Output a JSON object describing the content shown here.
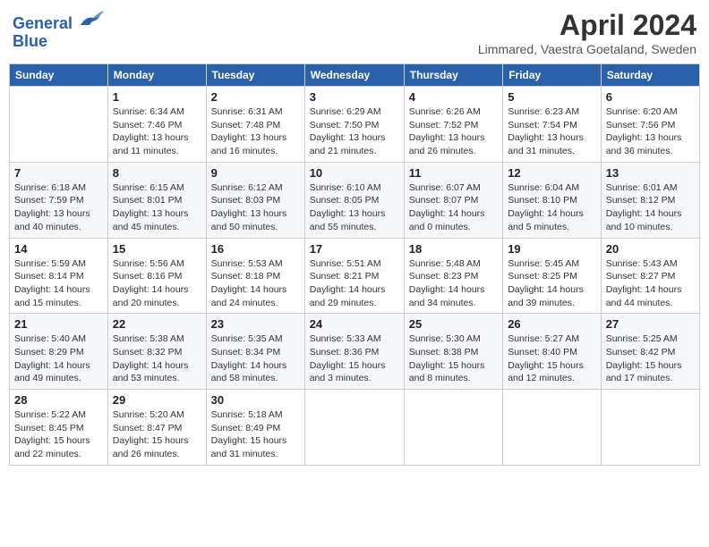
{
  "header": {
    "logo_line1": "General",
    "logo_line2": "Blue",
    "month_title": "April 2024",
    "location": "Limmared, Vaestra Goetaland, Sweden"
  },
  "days_of_week": [
    "Sunday",
    "Monday",
    "Tuesday",
    "Wednesday",
    "Thursday",
    "Friday",
    "Saturday"
  ],
  "weeks": [
    [
      {
        "day": "",
        "info": ""
      },
      {
        "day": "1",
        "info": "Sunrise: 6:34 AM\nSunset: 7:46 PM\nDaylight: 13 hours\nand 11 minutes."
      },
      {
        "day": "2",
        "info": "Sunrise: 6:31 AM\nSunset: 7:48 PM\nDaylight: 13 hours\nand 16 minutes."
      },
      {
        "day": "3",
        "info": "Sunrise: 6:29 AM\nSunset: 7:50 PM\nDaylight: 13 hours\nand 21 minutes."
      },
      {
        "day": "4",
        "info": "Sunrise: 6:26 AM\nSunset: 7:52 PM\nDaylight: 13 hours\nand 26 minutes."
      },
      {
        "day": "5",
        "info": "Sunrise: 6:23 AM\nSunset: 7:54 PM\nDaylight: 13 hours\nand 31 minutes."
      },
      {
        "day": "6",
        "info": "Sunrise: 6:20 AM\nSunset: 7:56 PM\nDaylight: 13 hours\nand 36 minutes."
      }
    ],
    [
      {
        "day": "7",
        "info": "Sunrise: 6:18 AM\nSunset: 7:59 PM\nDaylight: 13 hours\nand 40 minutes."
      },
      {
        "day": "8",
        "info": "Sunrise: 6:15 AM\nSunset: 8:01 PM\nDaylight: 13 hours\nand 45 minutes."
      },
      {
        "day": "9",
        "info": "Sunrise: 6:12 AM\nSunset: 8:03 PM\nDaylight: 13 hours\nand 50 minutes."
      },
      {
        "day": "10",
        "info": "Sunrise: 6:10 AM\nSunset: 8:05 PM\nDaylight: 13 hours\nand 55 minutes."
      },
      {
        "day": "11",
        "info": "Sunrise: 6:07 AM\nSunset: 8:07 PM\nDaylight: 14 hours\nand 0 minutes."
      },
      {
        "day": "12",
        "info": "Sunrise: 6:04 AM\nSunset: 8:10 PM\nDaylight: 14 hours\nand 5 minutes."
      },
      {
        "day": "13",
        "info": "Sunrise: 6:01 AM\nSunset: 8:12 PM\nDaylight: 14 hours\nand 10 minutes."
      }
    ],
    [
      {
        "day": "14",
        "info": "Sunrise: 5:59 AM\nSunset: 8:14 PM\nDaylight: 14 hours\nand 15 minutes."
      },
      {
        "day": "15",
        "info": "Sunrise: 5:56 AM\nSunset: 8:16 PM\nDaylight: 14 hours\nand 20 minutes."
      },
      {
        "day": "16",
        "info": "Sunrise: 5:53 AM\nSunset: 8:18 PM\nDaylight: 14 hours\nand 24 minutes."
      },
      {
        "day": "17",
        "info": "Sunrise: 5:51 AM\nSunset: 8:21 PM\nDaylight: 14 hours\nand 29 minutes."
      },
      {
        "day": "18",
        "info": "Sunrise: 5:48 AM\nSunset: 8:23 PM\nDaylight: 14 hours\nand 34 minutes."
      },
      {
        "day": "19",
        "info": "Sunrise: 5:45 AM\nSunset: 8:25 PM\nDaylight: 14 hours\nand 39 minutes."
      },
      {
        "day": "20",
        "info": "Sunrise: 5:43 AM\nSunset: 8:27 PM\nDaylight: 14 hours\nand 44 minutes."
      }
    ],
    [
      {
        "day": "21",
        "info": "Sunrise: 5:40 AM\nSunset: 8:29 PM\nDaylight: 14 hours\nand 49 minutes."
      },
      {
        "day": "22",
        "info": "Sunrise: 5:38 AM\nSunset: 8:32 PM\nDaylight: 14 hours\nand 53 minutes."
      },
      {
        "day": "23",
        "info": "Sunrise: 5:35 AM\nSunset: 8:34 PM\nDaylight: 14 hours\nand 58 minutes."
      },
      {
        "day": "24",
        "info": "Sunrise: 5:33 AM\nSunset: 8:36 PM\nDaylight: 15 hours\nand 3 minutes."
      },
      {
        "day": "25",
        "info": "Sunrise: 5:30 AM\nSunset: 8:38 PM\nDaylight: 15 hours\nand 8 minutes."
      },
      {
        "day": "26",
        "info": "Sunrise: 5:27 AM\nSunset: 8:40 PM\nDaylight: 15 hours\nand 12 minutes."
      },
      {
        "day": "27",
        "info": "Sunrise: 5:25 AM\nSunset: 8:42 PM\nDaylight: 15 hours\nand 17 minutes."
      }
    ],
    [
      {
        "day": "28",
        "info": "Sunrise: 5:22 AM\nSunset: 8:45 PM\nDaylight: 15 hours\nand 22 minutes."
      },
      {
        "day": "29",
        "info": "Sunrise: 5:20 AM\nSunset: 8:47 PM\nDaylight: 15 hours\nand 26 minutes."
      },
      {
        "day": "30",
        "info": "Sunrise: 5:18 AM\nSunset: 8:49 PM\nDaylight: 15 hours\nand 31 minutes."
      },
      {
        "day": "",
        "info": ""
      },
      {
        "day": "",
        "info": ""
      },
      {
        "day": "",
        "info": ""
      },
      {
        "day": "",
        "info": ""
      }
    ]
  ]
}
